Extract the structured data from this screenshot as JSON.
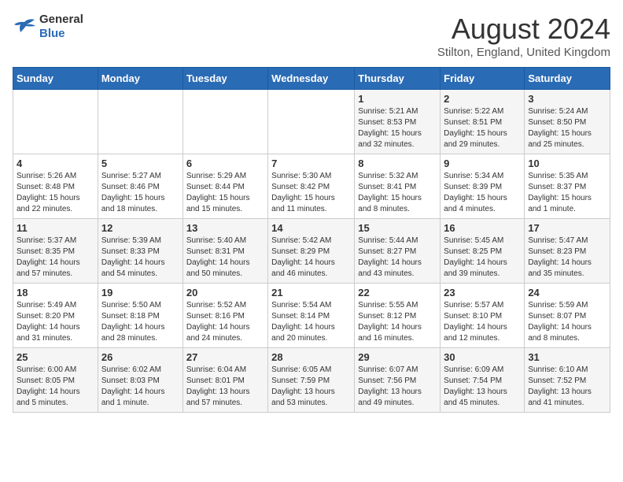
{
  "header": {
    "logo_general": "General",
    "logo_blue": "Blue",
    "month_year": "August 2024",
    "location": "Stilton, England, United Kingdom"
  },
  "days_of_week": [
    "Sunday",
    "Monday",
    "Tuesday",
    "Wednesday",
    "Thursday",
    "Friday",
    "Saturday"
  ],
  "weeks": [
    [
      {
        "day": "",
        "info": ""
      },
      {
        "day": "",
        "info": ""
      },
      {
        "day": "",
        "info": ""
      },
      {
        "day": "",
        "info": ""
      },
      {
        "day": "1",
        "info": "Sunrise: 5:21 AM\nSunset: 8:53 PM\nDaylight: 15 hours\nand 32 minutes."
      },
      {
        "day": "2",
        "info": "Sunrise: 5:22 AM\nSunset: 8:51 PM\nDaylight: 15 hours\nand 29 minutes."
      },
      {
        "day": "3",
        "info": "Sunrise: 5:24 AM\nSunset: 8:50 PM\nDaylight: 15 hours\nand 25 minutes."
      }
    ],
    [
      {
        "day": "4",
        "info": "Sunrise: 5:26 AM\nSunset: 8:48 PM\nDaylight: 15 hours\nand 22 minutes."
      },
      {
        "day": "5",
        "info": "Sunrise: 5:27 AM\nSunset: 8:46 PM\nDaylight: 15 hours\nand 18 minutes."
      },
      {
        "day": "6",
        "info": "Sunrise: 5:29 AM\nSunset: 8:44 PM\nDaylight: 15 hours\nand 15 minutes."
      },
      {
        "day": "7",
        "info": "Sunrise: 5:30 AM\nSunset: 8:42 PM\nDaylight: 15 hours\nand 11 minutes."
      },
      {
        "day": "8",
        "info": "Sunrise: 5:32 AM\nSunset: 8:41 PM\nDaylight: 15 hours\nand 8 minutes."
      },
      {
        "day": "9",
        "info": "Sunrise: 5:34 AM\nSunset: 8:39 PM\nDaylight: 15 hours\nand 4 minutes."
      },
      {
        "day": "10",
        "info": "Sunrise: 5:35 AM\nSunset: 8:37 PM\nDaylight: 15 hours\nand 1 minute."
      }
    ],
    [
      {
        "day": "11",
        "info": "Sunrise: 5:37 AM\nSunset: 8:35 PM\nDaylight: 14 hours\nand 57 minutes."
      },
      {
        "day": "12",
        "info": "Sunrise: 5:39 AM\nSunset: 8:33 PM\nDaylight: 14 hours\nand 54 minutes."
      },
      {
        "day": "13",
        "info": "Sunrise: 5:40 AM\nSunset: 8:31 PM\nDaylight: 14 hours\nand 50 minutes."
      },
      {
        "day": "14",
        "info": "Sunrise: 5:42 AM\nSunset: 8:29 PM\nDaylight: 14 hours\nand 46 minutes."
      },
      {
        "day": "15",
        "info": "Sunrise: 5:44 AM\nSunset: 8:27 PM\nDaylight: 14 hours\nand 43 minutes."
      },
      {
        "day": "16",
        "info": "Sunrise: 5:45 AM\nSunset: 8:25 PM\nDaylight: 14 hours\nand 39 minutes."
      },
      {
        "day": "17",
        "info": "Sunrise: 5:47 AM\nSunset: 8:23 PM\nDaylight: 14 hours\nand 35 minutes."
      }
    ],
    [
      {
        "day": "18",
        "info": "Sunrise: 5:49 AM\nSunset: 8:20 PM\nDaylight: 14 hours\nand 31 minutes."
      },
      {
        "day": "19",
        "info": "Sunrise: 5:50 AM\nSunset: 8:18 PM\nDaylight: 14 hours\nand 28 minutes."
      },
      {
        "day": "20",
        "info": "Sunrise: 5:52 AM\nSunset: 8:16 PM\nDaylight: 14 hours\nand 24 minutes."
      },
      {
        "day": "21",
        "info": "Sunrise: 5:54 AM\nSunset: 8:14 PM\nDaylight: 14 hours\nand 20 minutes."
      },
      {
        "day": "22",
        "info": "Sunrise: 5:55 AM\nSunset: 8:12 PM\nDaylight: 14 hours\nand 16 minutes."
      },
      {
        "day": "23",
        "info": "Sunrise: 5:57 AM\nSunset: 8:10 PM\nDaylight: 14 hours\nand 12 minutes."
      },
      {
        "day": "24",
        "info": "Sunrise: 5:59 AM\nSunset: 8:07 PM\nDaylight: 14 hours\nand 8 minutes."
      }
    ],
    [
      {
        "day": "25",
        "info": "Sunrise: 6:00 AM\nSunset: 8:05 PM\nDaylight: 14 hours\nand 5 minutes."
      },
      {
        "day": "26",
        "info": "Sunrise: 6:02 AM\nSunset: 8:03 PM\nDaylight: 14 hours\nand 1 minute."
      },
      {
        "day": "27",
        "info": "Sunrise: 6:04 AM\nSunset: 8:01 PM\nDaylight: 13 hours\nand 57 minutes."
      },
      {
        "day": "28",
        "info": "Sunrise: 6:05 AM\nSunset: 7:59 PM\nDaylight: 13 hours\nand 53 minutes."
      },
      {
        "day": "29",
        "info": "Sunrise: 6:07 AM\nSunset: 7:56 PM\nDaylight: 13 hours\nand 49 minutes."
      },
      {
        "day": "30",
        "info": "Sunrise: 6:09 AM\nSunset: 7:54 PM\nDaylight: 13 hours\nand 45 minutes."
      },
      {
        "day": "31",
        "info": "Sunrise: 6:10 AM\nSunset: 7:52 PM\nDaylight: 13 hours\nand 41 minutes."
      }
    ]
  ]
}
